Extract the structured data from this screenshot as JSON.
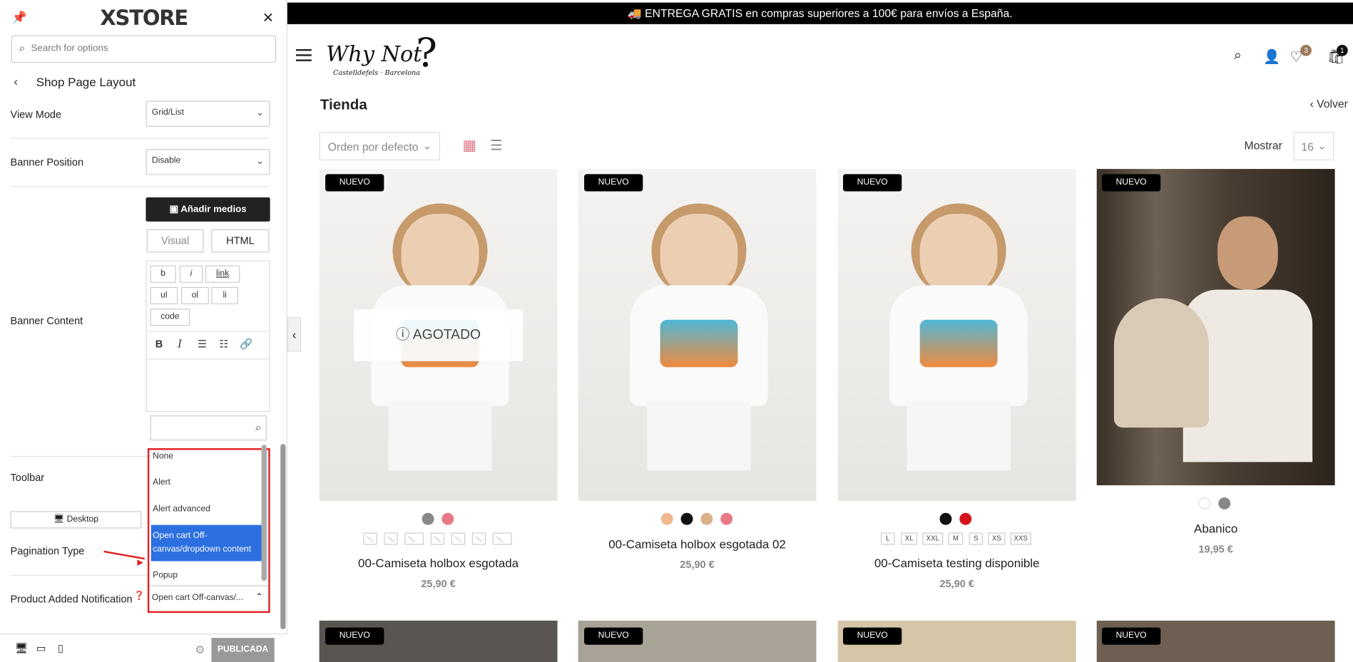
{
  "panel": {
    "logo": "XSTORE",
    "search_placeholder": "Search for options",
    "section_title": "Shop Page Layout",
    "view_mode": {
      "label": "View Mode",
      "value": "Grid/List"
    },
    "banner_position": {
      "label": "Banner Position",
      "value": "Disable"
    },
    "add_media": "Añadir medios",
    "tab_visual": "Visual",
    "tab_html": "HTML",
    "quicktags": [
      "b",
      "i",
      "link",
      "ul",
      "ol",
      "li",
      "code"
    ],
    "banner_content_label": "Banner Content",
    "toolbar_label": "Toolbar",
    "desktop_label": "Desktop",
    "pagination_label": "Pagination Type",
    "dropdown_options": [
      "None",
      "Alert",
      "Alert advanced",
      "Open cart Off-canvas/dropdown content",
      "Popup"
    ],
    "dropdown_selected_index": 3,
    "product_added": {
      "label": "Product Added Notification",
      "value": "Open cart Off-canvas/..."
    },
    "publish": "PUBLICADA"
  },
  "store": {
    "topbar": "🚚 ENTREGA GRATIS en compras superiores a 100€ para envíos a España.",
    "brand": "Why Not",
    "brand_mark": "?",
    "brand_sub": "Castelldefels · Barcelona",
    "wishlist_count": "3",
    "cart_count": "1",
    "page_title": "Tienda",
    "back": "‹ Volver",
    "sort": "Orden por defecto",
    "show_label": "Mostrar",
    "per_page": "16",
    "badge": "NUEVO",
    "sold_out": "AGOTADO",
    "products": [
      {
        "name": "00-Camiseta holbox esgotada",
        "price": "25,90 €"
      },
      {
        "name": "00-Camiseta holbox esgotada 02",
        "price": "25,90 €"
      },
      {
        "name": "00-Camiseta testing disponible",
        "price": "25,90 €",
        "sizes": [
          "L",
          "XL",
          "XXL",
          "M",
          "S",
          "XS",
          "XXS"
        ]
      },
      {
        "name": "Abanico",
        "price": "19,95 €"
      }
    ]
  }
}
